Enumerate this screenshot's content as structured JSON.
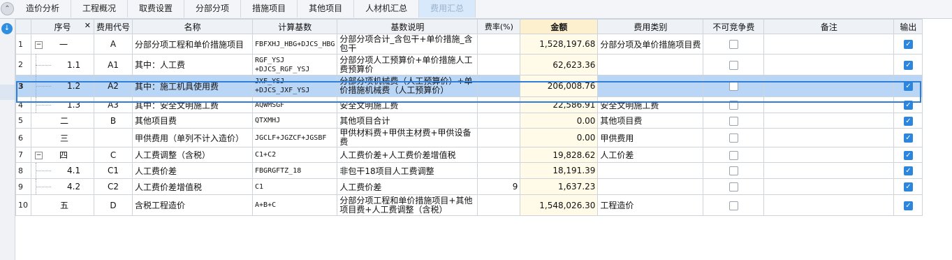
{
  "tabs": [
    {
      "label": "造价分析"
    },
    {
      "label": "工程概况"
    },
    {
      "label": "取费设置"
    },
    {
      "label": "分部分项"
    },
    {
      "label": "措施项目"
    },
    {
      "label": "其他项目"
    },
    {
      "label": "人材机汇总"
    },
    {
      "label": "费用汇总"
    }
  ],
  "active_tab": "费用汇总",
  "columns": {
    "seq": "序号",
    "close": "✕",
    "code": "费用代号",
    "name": "名称",
    "base": "计算基数",
    "base_desc": "基数说明",
    "rate": "费率(%)",
    "amount": "金额",
    "category": "费用类别",
    "noncomp": "不可竞争费",
    "remark": "备注",
    "output": "输出"
  },
  "rows": [
    {
      "rownum": "1",
      "seq": "一",
      "code": "A",
      "name": "分部分项工程和单价措施项目",
      "base": "FBFXHJ_HBG+DJCS_HBG",
      "base_desc": "分部分项合计_含包干+单价措施_含包干",
      "rate": "",
      "amount": "1,528,197.68",
      "category": "分部分项及单价措施项目费",
      "noncomp": false,
      "remark": "",
      "output": true
    },
    {
      "rownum": "2",
      "seq": "1.1",
      "code": "A1",
      "name": "其中：人工费",
      "base": "RGF_YSJ +DJCS_RGF_YSJ",
      "base_desc": "分部分项人工预算价+单价措施人工费预算价",
      "rate": "",
      "amount": "62,623.36",
      "category": "",
      "noncomp": false,
      "remark": "",
      "output": true
    },
    {
      "rownum": "3",
      "seq": "1.2",
      "code": "A2",
      "name": "其中：施工机具使用费",
      "base": "JXF_YSJ +DJCS_JXF_YSJ",
      "base_desc": "分部分项机械费（人工预算价）+单价措施机械费（人工预算价）",
      "rate": "",
      "amount": "206,008.76",
      "category": "",
      "noncomp": false,
      "remark": "",
      "output": true
    },
    {
      "rownum": "4",
      "seq": "1.3",
      "code": "A3",
      "name": "其中：安全文明施工费",
      "base": "AQWMSGF",
      "base_desc": "安全文明施工费",
      "rate": "",
      "amount": "22,586.91",
      "category": "安全文明施工费",
      "noncomp": false,
      "remark": "",
      "output": true
    },
    {
      "rownum": "5",
      "seq": "二",
      "code": "B",
      "name": "其他项目费",
      "base": "QTXMHJ",
      "base_desc": "其他项目合计",
      "rate": "",
      "amount": "0.00",
      "category": "其他项目费",
      "noncomp": false,
      "remark": "",
      "output": true
    },
    {
      "rownum": "6",
      "seq": "三",
      "code": "",
      "name": "甲供费用（单列不计入造价）",
      "base": "JGCLF+JGZCF+JGSBF",
      "base_desc": "甲供材料费+甲供主材费+甲供设备费",
      "rate": "",
      "amount": "0.00",
      "category": "甲供费用",
      "noncomp": false,
      "remark": "",
      "output": true
    },
    {
      "rownum": "7",
      "seq": "四",
      "code": "C",
      "name": "人工费调整（含税）",
      "base": "C1+C2",
      "base_desc": "人工费价差+人工费价差增值税",
      "rate": "",
      "amount": "19,828.62",
      "category": "人工价差",
      "noncomp": false,
      "remark": "",
      "output": true
    },
    {
      "rownum": "8",
      "seq": "4.1",
      "code": "C1",
      "name": "人工费价差",
      "base": "FBGRGFTZ_18",
      "base_desc": "非包干18项目人工费调整",
      "rate": "",
      "amount": "18,191.39",
      "category": "",
      "noncomp": false,
      "remark": "",
      "output": true
    },
    {
      "rownum": "9",
      "seq": "4.2",
      "code": "C2",
      "name": "人工费价差增值税",
      "base": "C1",
      "base_desc": "人工费价差",
      "rate": "9",
      "amount": "1,637.23",
      "category": "",
      "noncomp": false,
      "remark": "",
      "output": true
    },
    {
      "rownum": "10",
      "seq": "五",
      "code": "D",
      "name": "含税工程造价",
      "base": "A+B+C",
      "base_desc": "分部分项工程和单价措施项目+其他项目费+人工费调整（含税）",
      "rate": "",
      "amount": "1,548,026.30",
      "category": "工程造价",
      "noncomp": false,
      "remark": "",
      "output": true
    }
  ]
}
